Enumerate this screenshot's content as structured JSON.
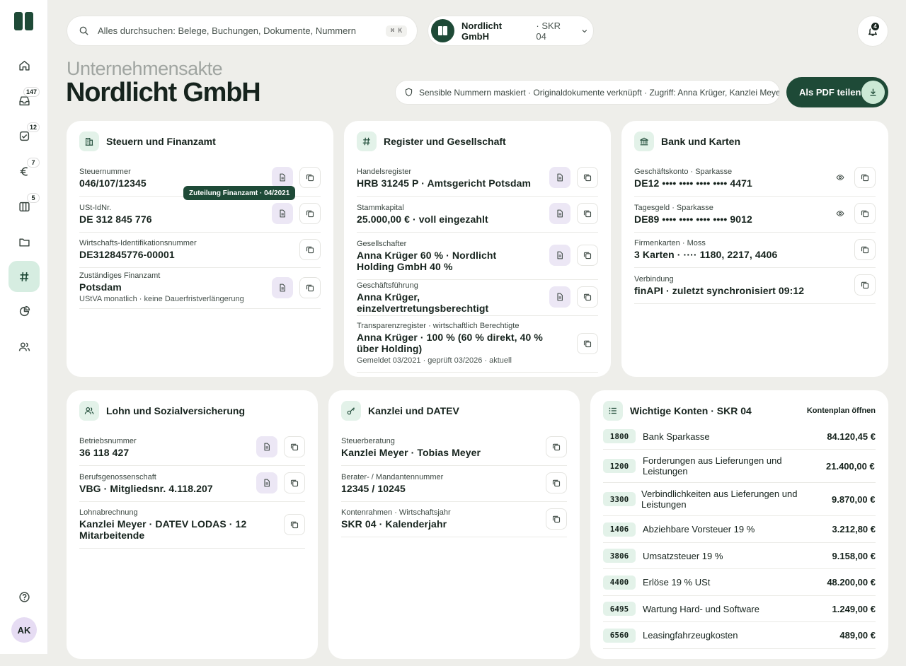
{
  "nav": {
    "items": [
      {
        "name": "home-icon",
        "badge": ""
      },
      {
        "name": "inbox-icon",
        "badge": "147"
      },
      {
        "name": "tasks-icon",
        "badge": "12"
      },
      {
        "name": "euro-icon",
        "badge": "7"
      },
      {
        "name": "columns-icon",
        "badge": "5"
      },
      {
        "name": "folder-icon",
        "badge": ""
      },
      {
        "name": "hash-icon",
        "badge": ""
      },
      {
        "name": "pie-chart-icon",
        "badge": ""
      },
      {
        "name": "users-icon",
        "badge": ""
      }
    ],
    "avatar": "AK"
  },
  "search": {
    "placeholder": "Alles durchsuchen: Belege, Buchungen, Dokumente, Nummern",
    "shortcut": "⌘ K"
  },
  "company": {
    "name": "Nordlicht GmbH",
    "skr": "· SKR 04"
  },
  "notifications": {
    "count": "4"
  },
  "header": {
    "kicker": "Unternehmensakte",
    "title": "Nordlicht GmbH",
    "security": "Sensible Nummern maskiert · Originaldokumente verknüpft · Zugriff: Anna Krüger, Kanzlei Meyer",
    "pdf_label": "Als PDF teilen"
  },
  "tooltip": "Zuteilung Finanzamt · 04/2021",
  "steuern": {
    "title": "Steuern und Finanzamt",
    "rows": [
      {
        "label": "Steuernummer",
        "value": "046/107/12345",
        "sub": ""
      },
      {
        "label": "USt-IdNr.",
        "value": "DE 312 845 776",
        "sub": ""
      },
      {
        "label": "Wirtschafts-Identifikationsnummer",
        "value": "DE312845776-00001",
        "sub": ""
      },
      {
        "label": "Zuständiges Finanzamt",
        "value": "Potsdam",
        "sub": "UStVA monatlich · keine Dauerfristverlängerung"
      }
    ]
  },
  "register": {
    "title": "Register und Gesellschaft",
    "rows": [
      {
        "label": "Handelsregister",
        "value": "HRB 31245 P · Amtsgericht Potsdam",
        "sub": ""
      },
      {
        "label": "Stammkapital",
        "value": "25.000,00 € · voll eingezahlt",
        "sub": ""
      },
      {
        "label": "Gesellschafter",
        "value": "Anna Krüger 60 % · Nordlicht Holding GmbH 40 %",
        "sub": ""
      },
      {
        "label": "Geschäftsführung",
        "value": "Anna Krüger, einzelvertretungsberechtigt",
        "sub": ""
      },
      {
        "label": "Transparenzregister · wirtschaftlich Berechtigte",
        "value": "Anna Krüger · 100 % (60 % direkt, 40 % über Holding)",
        "sub": "Gemeldet 03/2021 · geprüft 03/2026 · aktuell"
      }
    ]
  },
  "bank": {
    "title": "Bank und Karten",
    "rows": [
      {
        "label": "Geschäftskonto · Sparkasse",
        "value": "DE12 •••• •••• •••• •••• 4471",
        "sub": ""
      },
      {
        "label": "Tagesgeld · Sparkasse",
        "value": "DE89 •••• •••• •••• •••• 9012",
        "sub": ""
      },
      {
        "label": "Firmenkarten · Moss",
        "value": "3 Karten · ···· 1180, 2217, 4406",
        "sub": ""
      },
      {
        "label": "Verbindung",
        "value": "finAPI · zuletzt synchronisiert 09:12",
        "sub": ""
      }
    ]
  },
  "lohn": {
    "title": "Lohn und Sozialversicherung",
    "rows": [
      {
        "label": "Betriebsnummer",
        "value": "36 118 427",
        "sub": ""
      },
      {
        "label": "Berufsgenossenschaft",
        "value": "VBG · Mitgliedsnr. 4.118.207",
        "sub": ""
      },
      {
        "label": "Lohnabrechnung",
        "value": "Kanzlei Meyer · DATEV LODAS · 12 Mitarbeitende",
        "sub": ""
      }
    ]
  },
  "kanzlei": {
    "title": "Kanzlei und DATEV",
    "rows": [
      {
        "label": "Steuerberatung",
        "value": "Kanzlei Meyer · Tobias Meyer",
        "sub": ""
      },
      {
        "label": "Berater- / Mandantennummer",
        "value": "12345 / 10245",
        "sub": ""
      },
      {
        "label": "Kontenrahmen · Wirtschaftsjahr",
        "value": "SKR 04 · Kalenderjahr",
        "sub": ""
      }
    ]
  },
  "konten": {
    "title": "Wichtige Konten · SKR 04",
    "link": "Kontenplan öffnen",
    "rows": [
      {
        "code": "1800",
        "name": "Bank Sparkasse",
        "amount": "84.120,45 €"
      },
      {
        "code": "1200",
        "name": "Forderungen aus Lieferungen und Leistungen",
        "amount": "21.400,00 €"
      },
      {
        "code": "3300",
        "name": "Verbindlichkeiten aus Lieferungen und Leistungen",
        "amount": "9.870,00 €"
      },
      {
        "code": "1406",
        "name": "Abziehbare Vorsteuer 19 %",
        "amount": "3.212,80 €"
      },
      {
        "code": "3806",
        "name": "Umsatzsteuer 19 %",
        "amount": "9.158,00 €"
      },
      {
        "code": "4400",
        "name": "Erlöse 19 % USt",
        "amount": "48.200,00 €"
      },
      {
        "code": "6495",
        "name": "Wartung Hard- und Software",
        "amount": "1.249,00 €"
      },
      {
        "code": "6560",
        "name": "Leasingfahrzeugkosten",
        "amount": "489,00 €"
      }
    ]
  },
  "colors": {
    "brand": "#1e4a37",
    "accent_light": "#e3f2e9",
    "doc_button": "#ece7f5"
  }
}
